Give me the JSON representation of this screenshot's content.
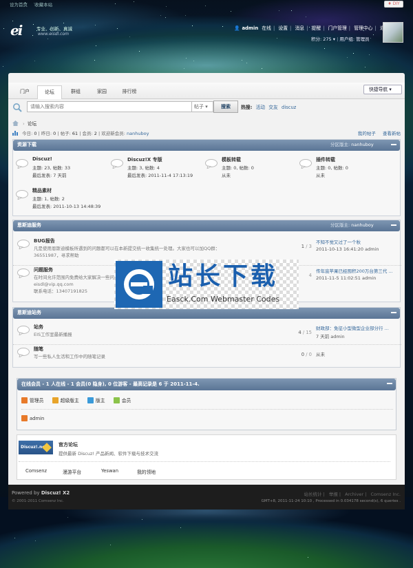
{
  "top": {
    "links": [
      "设为首页",
      "收藏本站"
    ],
    "diy_label": "DIY"
  },
  "logo": {
    "mark": "ei",
    "slogan": "专业、创新、真诚",
    "url": "www.eisdl.com"
  },
  "user_nav": {
    "username": "admin",
    "online_label": "在线",
    "items": [
      "设置",
      "消息",
      "提醒",
      "门户管理",
      "管理中心",
      "退出"
    ],
    "credits": "积分: 275",
    "group": "用户组: 管理员"
  },
  "nav": {
    "items": [
      "门户",
      "论坛",
      "群组",
      "家园",
      "排行榜"
    ],
    "active": "论坛",
    "quick_nav": "快捷导航"
  },
  "search": {
    "placeholder": "请输入搜索内容",
    "type": "帖子",
    "button": "搜索",
    "hot_label": "热搜:",
    "hot_terms": [
      "活动",
      "交友",
      "discuz"
    ]
  },
  "breadcrumb": {
    "current": "论坛"
  },
  "stats": {
    "today_label": "今日:",
    "today": "0",
    "yesterday_label": "昨日:",
    "yesterday": "0",
    "posts_label": "帖子:",
    "posts": "61",
    "members_label": "会员:",
    "members": "2",
    "welcome_label": "欢迎新会员:",
    "new_member": "nanhuboy",
    "my_posts": "我的帖子",
    "new_posts": "查看新帖"
  },
  "categories": [
    {
      "title": "资源下载",
      "mod_label": "分区版主:",
      "mod": "nanhuboy",
      "forums": [
        {
          "name": "Discuz!",
          "line1": "主题: 23, 帖数: 33",
          "line2": "最后发表: 7 天前"
        },
        {
          "name": "Discuz!X 专版",
          "line1": "主题: 3, 帖数: 4",
          "line2": "最后发表: 2011-11-4 17:13:19"
        },
        {
          "name": "模板转载",
          "line1": "主题: 0, 帖数: 0",
          "line2": "从未"
        },
        {
          "name": "插件转载",
          "line1": "主题: 0, 帖数: 0",
          "line2": "从未"
        },
        {
          "name": "精品素材",
          "line1": "主题: 1, 帖数: 2",
          "line2": "最后发表: 2011-10-13 14:48:39"
        }
      ]
    },
    {
      "title": "恩斯迪服务",
      "mod_label": "分区版主:",
      "mod": "nanhuboy",
      "rows": [
        {
          "name": "BUG报告",
          "desc": "凡是使用恩斯迪模板所遇到的问题都可以在本新提交统一收集统一处理。大家也可以加QQ群：36551987，寻求帮助",
          "count": "1",
          "total": "3",
          "last_title": "不知不觉又过了一个秋",
          "last_meta": "2011-10-13 16:41:20 admin"
        },
        {
          "name": "问题服务",
          "desc": "在时间允许范围内免费给大家解决一些问题",
          "desc2": "eisdl@vip.qq.com",
          "desc3": "联系电话：13407191825",
          "count": "",
          "total": "4",
          "last_title": "传年底苹果已经囤积200万台第三代 ...",
          "last_meta": "2011-11-5 11:02:51 admin"
        }
      ]
    },
    {
      "title": "恩斯迪站务",
      "rows": [
        {
          "name": "站务",
          "desc": "EIS工作室最新播报",
          "count": "4",
          "total": "15",
          "last_title": "财政部：免征小型微型企业部分行 ...",
          "last_meta": "7 天前 admin"
        },
        {
          "name": "随笔",
          "desc": "写一些私人生活和工作中的随笔记录",
          "count": "0",
          "total": "0",
          "last_title": "",
          "last_meta": "从未"
        }
      ]
    }
  ],
  "online": {
    "title": "在线会员 - 1 人在线 - 1 会员(0 隐身), 0 位游客 - 最高记录是 6 于 2011-11-4.",
    "legend": [
      {
        "label": "管理员",
        "color": "#e87a2a"
      },
      {
        "label": "超级版主",
        "color": "#e8a42a"
      },
      {
        "label": "版主",
        "color": "#3a9ad9"
      },
      {
        "label": "会员",
        "color": "#8bc34a"
      }
    ],
    "users": [
      "admin"
    ]
  },
  "links": {
    "logo_text": "Discuz!.net",
    "title": "官方论坛",
    "desc": "提供最新 Discuz! 产品新闻、软件下载与技术交流",
    "text_links": [
      "Comsenz",
      "漫游平台",
      "Yeswan",
      "我的领地"
    ]
  },
  "footer": {
    "powered_prefix": "Powered by",
    "product": "Discuz! X2",
    "copyright": "© 2001-2011 Comsenz Inc.",
    "links": [
      "站长统计",
      "举报",
      "Archiver",
      "Comsenz Inc."
    ],
    "time": "GMT+8, 2011-11-24 10:10 , Processed in 0.034178 second(s), 6 queries ."
  },
  "watermark": {
    "title": "站长下载",
    "subtitle": "Easck.Com Webmaster Codes"
  },
  "colors": {
    "category_header": "#6a84a3",
    "link": "#336699",
    "footer_bg": "#1d1d1d"
  }
}
